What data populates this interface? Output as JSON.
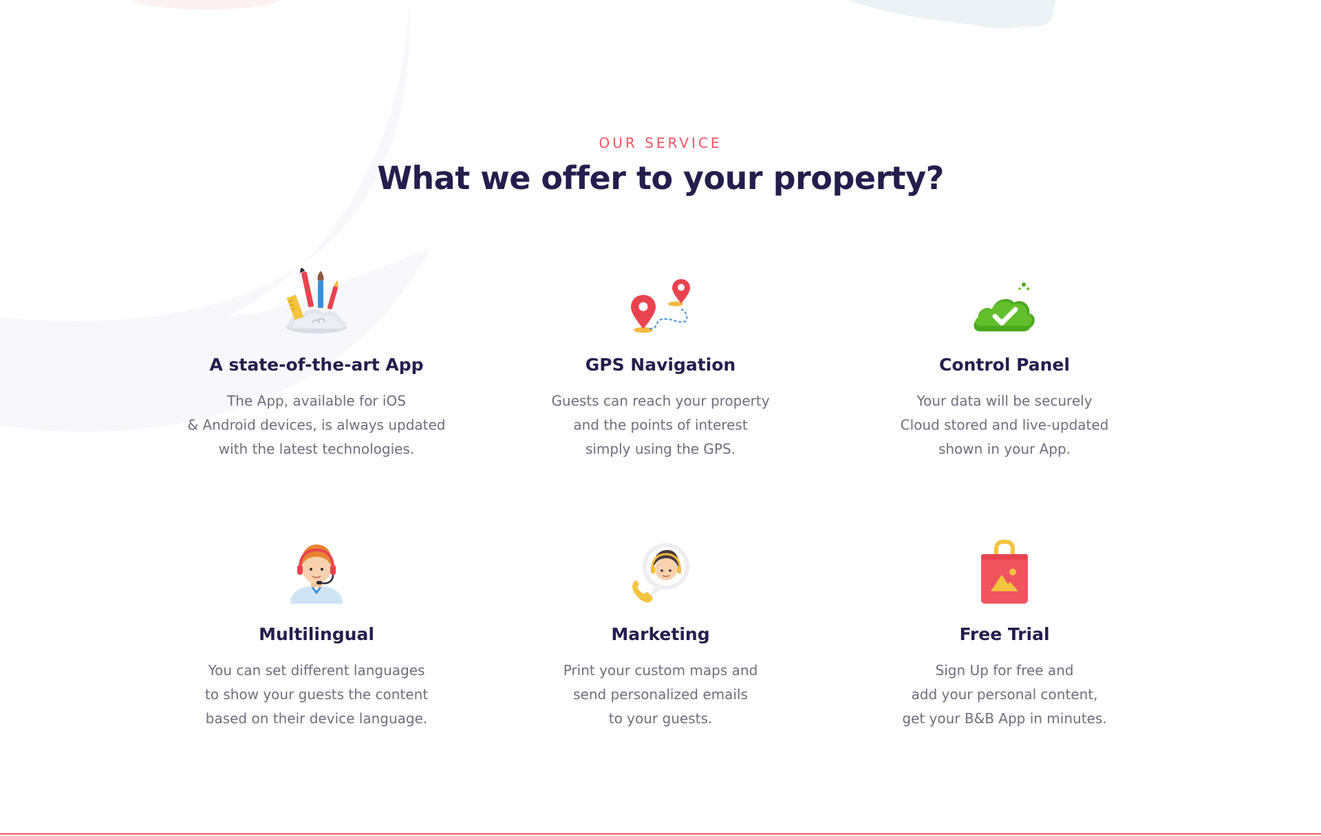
{
  "section": {
    "kicker": "OUR SERVICE",
    "title": "What we offer to your property?"
  },
  "services": [
    {
      "icon": "art-tools-icon",
      "title": "A state-of-the-art App",
      "lines": [
        "The App, available for iOS",
        "& Android devices, is always updated",
        "with the latest technologies."
      ]
    },
    {
      "icon": "map-pins-route-icon",
      "title": "GPS Navigation",
      "lines": [
        "Guests can reach your property",
        "and the points of interest",
        "simply using the GPS."
      ]
    },
    {
      "icon": "cloud-check-icon",
      "title": "Control Panel",
      "lines": [
        "Your data will be securely",
        "Cloud stored and live-updated",
        "shown in your App."
      ]
    },
    {
      "icon": "support-agent-icon",
      "title": "Multilingual",
      "lines": [
        "You can set different languages",
        "to show your guests the content",
        "based on their device language."
      ]
    },
    {
      "icon": "call-agent-icon",
      "title": "Marketing",
      "lines": [
        "Print your custom maps and",
        "send personalized emails",
        "to your guests."
      ]
    },
    {
      "icon": "shopping-bag-icon",
      "title": "Free Trial",
      "lines": [
        "Sign Up for free and",
        "add your personal content,",
        "get your B&B App in minutes."
      ]
    }
  ],
  "colors": {
    "accent": "#f0545f",
    "heading": "#241e4e",
    "body_text": "#6e6e7e",
    "background_shape": "#f7f7fc"
  }
}
